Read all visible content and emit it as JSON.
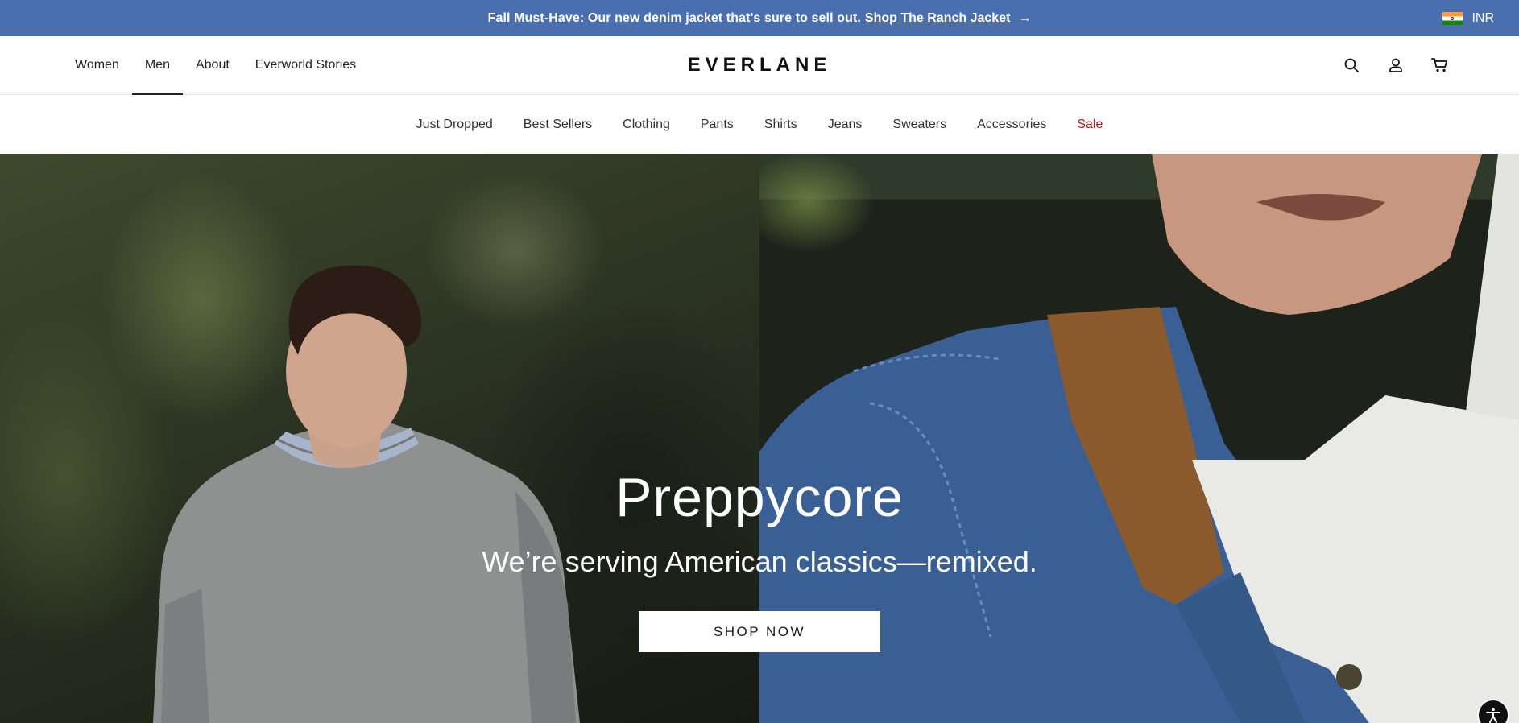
{
  "announcement": {
    "message": "Fall Must-Have: Our new denim jacket that's sure to sell out.",
    "link_text": "Shop The Ranch Jacket",
    "arrow": "→",
    "currency": "INR"
  },
  "header": {
    "logo": "EVERLANE",
    "nav": [
      {
        "label": "Women"
      },
      {
        "label": "Men",
        "active": true
      },
      {
        "label": "About"
      },
      {
        "label": "Everworld Stories"
      }
    ],
    "icons": [
      "search-icon",
      "account-icon",
      "cart-icon"
    ]
  },
  "categories": [
    {
      "label": "Just Dropped"
    },
    {
      "label": "Best Sellers"
    },
    {
      "label": "Clothing"
    },
    {
      "label": "Pants"
    },
    {
      "label": "Shirts"
    },
    {
      "label": "Jeans"
    },
    {
      "label": "Sweaters"
    },
    {
      "label": "Accessories"
    },
    {
      "label": "Sale",
      "highlight": true
    }
  ],
  "hero": {
    "title": "Preppycore",
    "subtitle": "We’re serving American classics—remixed.",
    "cta": "SHOP NOW"
  },
  "colors": {
    "announcement_bg": "#4a6fae",
    "sale": "#b31b1b",
    "text": "#1a1a1a"
  }
}
